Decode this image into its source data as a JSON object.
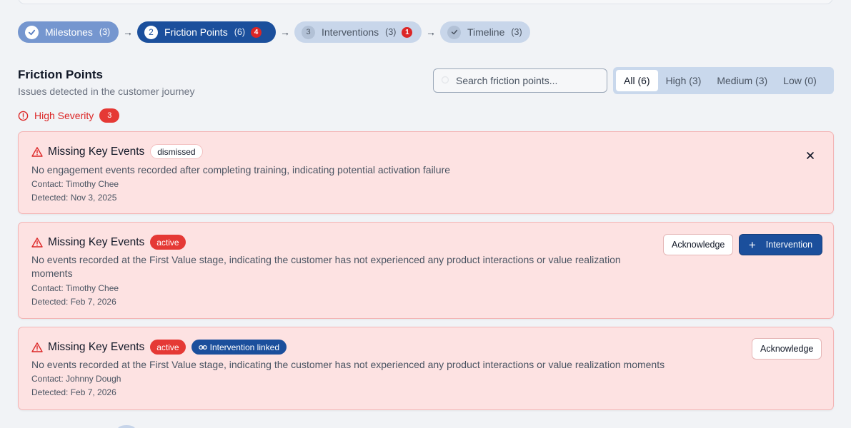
{
  "stepper": [
    {
      "num": "",
      "label": "Milestones",
      "count": "(3)",
      "alert": ""
    },
    {
      "num": "2",
      "label": "Friction Points",
      "count": "(6)",
      "alert": "4"
    },
    {
      "num": "3",
      "label": "Interventions",
      "count": "(3)",
      "alert": "1"
    },
    {
      "num": "",
      "label": "Timeline",
      "count": "(3)",
      "alert": ""
    }
  ],
  "header": {
    "title": "Friction Points",
    "subtitle": "Issues detected in the customer journey",
    "search_placeholder": "Search friction points..."
  },
  "filters": [
    "All (6)",
    "High (3)",
    "Medium (3)",
    "Low (0)"
  ],
  "severity_group": {
    "label": "High Severity",
    "count": "3"
  },
  "cards": [
    {
      "title": "Missing Key Events",
      "status": "dismissed",
      "description": "No engagement events recorded after completing training, indicating potential activation failure",
      "contact": "Contact: Timothy Chee",
      "detected": "Detected: Nov 3, 2025"
    },
    {
      "title": "Missing Key Events",
      "status": "active",
      "description": "No events recorded at the First Value stage, indicating the customer has not experienced any product interactions or value realization moments",
      "contact": "Contact: Timothy Chee",
      "detected": "Detected: Feb 7, 2026",
      "ack_label": "Acknowledge",
      "intervention_label": "Intervention"
    },
    {
      "title": "Missing Key Events",
      "status": "active",
      "linked": "Intervention linked",
      "description": "No events recorded at the First Value stage, indicating the customer has not experienced any product interactions or value realization moments",
      "contact": "Contact: Johnny Dough",
      "detected": "Detected: Feb 7, 2026",
      "ack_label": "Acknowledge"
    }
  ],
  "colors": {
    "primary": "#1b4f9c",
    "danger": "#e53935",
    "card_bg": "#fde2e2"
  }
}
